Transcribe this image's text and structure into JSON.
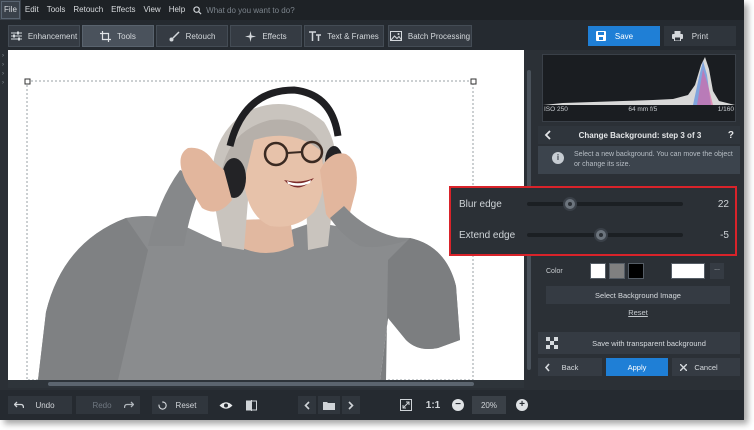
{
  "menu": {
    "items": [
      "File",
      "Edit",
      "Tools",
      "Retouch",
      "Effects",
      "View",
      "Help"
    ],
    "search_placeholder": "What do you want to do?"
  },
  "tabs": [
    {
      "label": "Enhancement",
      "icon": "sliders-icon"
    },
    {
      "label": "Tools",
      "icon": "crop-icon",
      "active": true
    },
    {
      "label": "Retouch",
      "icon": "brush-icon"
    },
    {
      "label": "Effects",
      "icon": "sparkle-icon"
    },
    {
      "label": "Text & Frames",
      "icon": "text-icon"
    },
    {
      "label": "Batch Processing",
      "icon": "images-icon"
    }
  ],
  "actions": {
    "save": "Save",
    "print": "Print"
  },
  "histogram": {
    "iso": "ISO 250",
    "lens": "64 mm f/5",
    "shutter": "1/160"
  },
  "step": {
    "title": "Change Background: step 3 of 3",
    "help": "?",
    "info": "Select a new background. You can move the object or change its size."
  },
  "sliders": [
    {
      "label": "Blur edge",
      "value": "22",
      "fraction": 0.25
    },
    {
      "label": "Extend edge",
      "value": "-5",
      "fraction": 0.47
    }
  ],
  "color": {
    "label": "Color",
    "swatches": [
      "#ffffff",
      "#808080",
      "#000000"
    ],
    "custom": "#ffffff",
    "more": "..."
  },
  "select_bg": "Select Background Image",
  "reset_link": "Reset",
  "save_transparent": "Save with transparent background",
  "nav": {
    "back": "Back",
    "apply": "Apply",
    "cancel": "Cancel"
  },
  "bottom": {
    "undo": "Undo",
    "redo": "Redo",
    "reset": "Reset",
    "one_to_one": "1:1",
    "zoom": "20%"
  },
  "colors": {
    "accent": "#1f7fd6",
    "highlight": "#d9232a"
  }
}
